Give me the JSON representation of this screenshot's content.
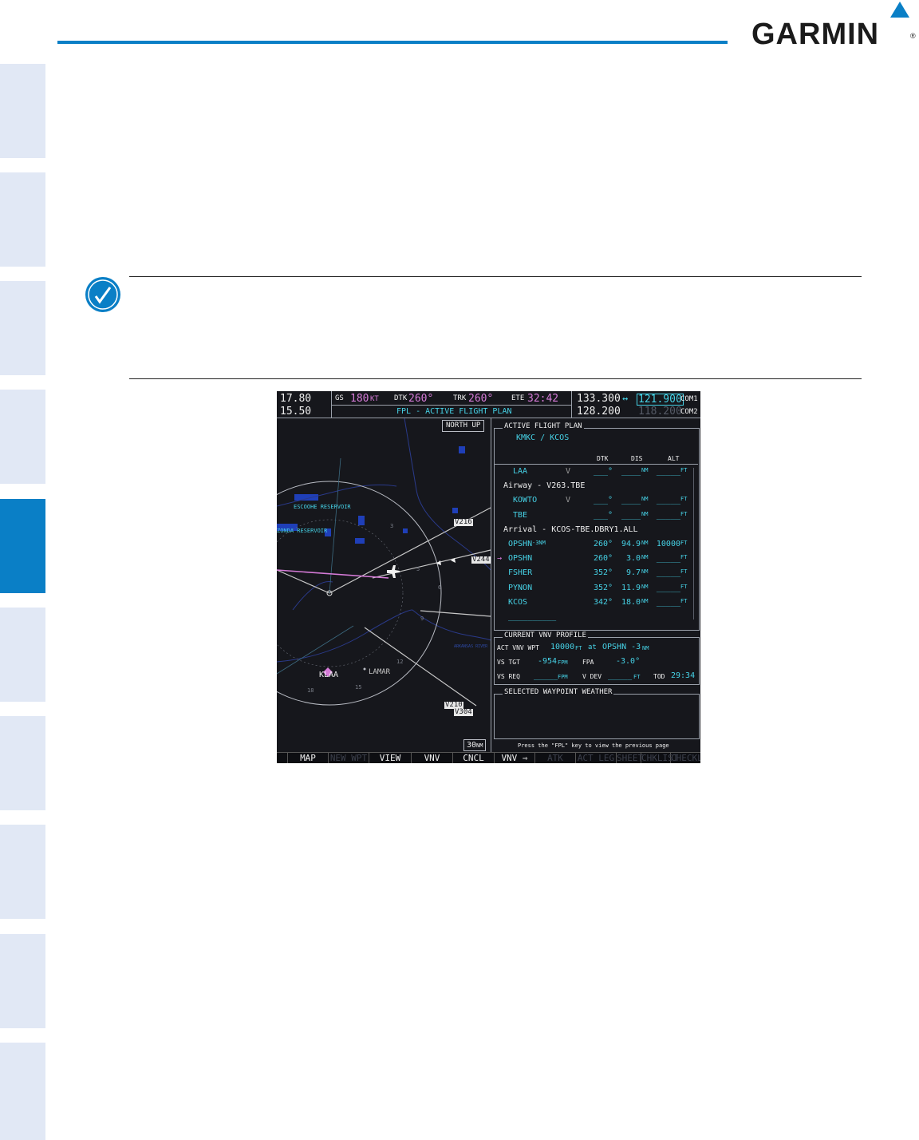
{
  "header": {
    "brand": "GARMIN",
    "reg_mark": "®"
  },
  "tabs": [
    "tab1",
    "tab2",
    "tab3",
    "tab4",
    "tab5",
    "tab6",
    "tab7",
    "tab8",
    "tab9",
    "tab10"
  ],
  "mfd": {
    "nav1_freq": "17.80",
    "nav2_freq": "15.50",
    "gs_label": "GS",
    "gs_value": "180",
    "gs_unit": "KT",
    "dtk_label": "DTK",
    "dtk_value": "260°",
    "trk_label": "TRK",
    "trk_value": "260°",
    "ete_label": "ETE",
    "ete_value": "32:42",
    "com1_active": "133.300",
    "com1_swap": "↔",
    "com1_standby": "121.900",
    "com1_label": "COM1",
    "com2_active": "128.200",
    "com2_standby": "118.200",
    "com2_label": "COM2",
    "page_title": "FPL - ACTIVE FLIGHT PLAN",
    "map": {
      "orientation": "NORTH UP",
      "range": "30",
      "range_unit": "NM",
      "labels": {
        "reservoir1": "ESCOOHE RESERVOIR",
        "reservoir2": "ZONDA RESERVOIR",
        "river": "ARKANSAS RIVER",
        "airway1": "V216",
        "airway2": "V244",
        "airway3": "V210",
        "airway4": "V304",
        "airport": "KLAA",
        "town": "LAMAR",
        "ring3": "3",
        "ring5": "5",
        "ring6": "6",
        "ring9": "9",
        "ring12": "12",
        "ring15": "15",
        "ring18": "18"
      }
    },
    "fpl": {
      "section_title": "ACTIVE FLIGHT PLAN",
      "route": "KMKC / KCOS",
      "col_dtk": "DTK",
      "col_dis": "DIS",
      "col_alt": "ALT",
      "rows": [
        {
          "name": "LAA",
          "sym": "V",
          "dtk": "___°",
          "dis": "____",
          "dis_u": "NM",
          "alt": "_____",
          "alt_u": "FT"
        },
        {
          "header": "Airway - V263.TBE"
        },
        {
          "name": "KOWTO",
          "sym": "V",
          "dtk": "___°",
          "dis": "____",
          "dis_u": "NM",
          "alt": "_____",
          "alt_u": "FT"
        },
        {
          "name": "TBE",
          "sym": "",
          "dtk": "___°",
          "dis": "____",
          "dis_u": "NM",
          "alt": "_____",
          "alt_u": "FT"
        },
        {
          "header": "Arrival - KCOS-TBE.DBRY1.ALL"
        },
        {
          "name": "OPSHN",
          "suffix": "-3NM",
          "dtk": "260°",
          "dis": "94.9",
          "dis_u": "NM",
          "alt": "10000",
          "alt_u": "FT"
        },
        {
          "name": "OPSHN",
          "active": "→",
          "dtk": "260°",
          "dis": "3.0",
          "dis_u": "NM",
          "alt": "_____",
          "alt_u": "FT"
        },
        {
          "name": "FSHER",
          "dtk": "352°",
          "dis": "9.7",
          "dis_u": "NM",
          "alt": "_____",
          "alt_u": "FT"
        },
        {
          "name": "PYNON",
          "dtk": "352°",
          "dis": "11.9",
          "dis_u": "NM",
          "alt": "_____",
          "alt_u": "FT"
        },
        {
          "name": "KCOS",
          "dtk": "342°",
          "dis": "18.0",
          "dis_u": "NM",
          "alt": "_____",
          "alt_u": "FT"
        },
        {
          "name": "__________"
        }
      ]
    },
    "vnv": {
      "section_title": "CURRENT VNV PROFILE",
      "act_label": "ACT VNV WPT",
      "act_alt": "10000",
      "act_alt_u": "FT",
      "act_at": "at",
      "act_wpt": "OPSHN -3",
      "act_wpt_u": "NM",
      "vs_tgt_label": "VS TGT",
      "vs_tgt_value": "-954",
      "vs_tgt_u": "FPM",
      "fpa_label": "FPA",
      "fpa_value": "-3.0°",
      "vs_req_label": "VS REQ",
      "vs_req_value": "_____",
      "vs_req_u": "FPM",
      "vdev_label": "V DEV",
      "vdev_value": "_____",
      "vdev_u": "FT",
      "tod_label": "TOD",
      "tod_value": "29:34"
    },
    "wx": {
      "section_title": "SELECTED WAYPOINT WEATHER",
      "prompt": "Press the \"FPL\" key to view the previous page"
    },
    "softkeys": [
      "",
      "MAP",
      "NEW WPT",
      "VIEW",
      "VNV PROF",
      "CNCL VNV",
      "VNV ⇾",
      "ATK OFST",
      "ACT LEG",
      "SHEET",
      "CHKLIST",
      "CHECKLIST"
    ]
  }
}
